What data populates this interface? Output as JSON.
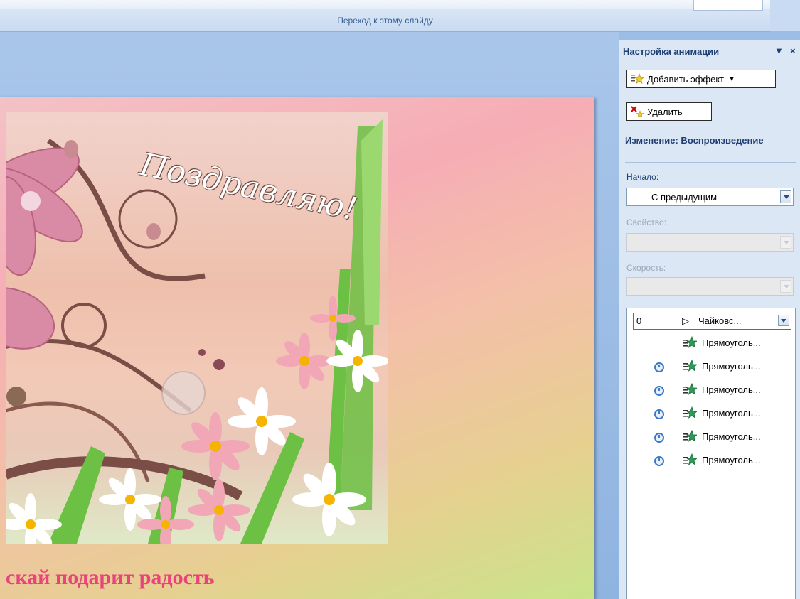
{
  "ribbon": {
    "group_label": "Переход к этому слайду"
  },
  "slide": {
    "picture_text": "Поздравляю!",
    "caption": "скай подарит радость"
  },
  "pane": {
    "title": "Настройка анимации",
    "add_effect": "Добавить эффект",
    "remove": "Удалить",
    "change_label": "Изменение: Воспроизведение",
    "start_label": "Начало:",
    "start_value": "С предыдущим",
    "property_label": "Свойство:",
    "speed_label": "Скорость:",
    "list": [
      {
        "num": "0",
        "name": "Чайковс..."
      },
      {
        "name": "Прямоуголь..."
      },
      {
        "name": "Прямоуголь..."
      },
      {
        "name": "Прямоуголь..."
      },
      {
        "name": "Прямоуголь..."
      },
      {
        "name": "Прямоуголь..."
      },
      {
        "name": "Прямоуголь..."
      }
    ]
  }
}
